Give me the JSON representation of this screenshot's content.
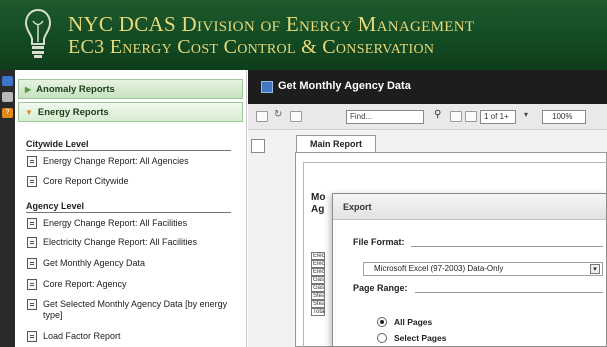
{
  "header": {
    "line1": "NYC DCAS Division of Energy Management",
    "line2": "EC3 Energy Cost Control & Conservation"
  },
  "sidebar": {
    "accordion": [
      {
        "label": "Anomaly Reports",
        "state": "collapsed"
      },
      {
        "label": "Energy Reports",
        "state": "expanded"
      }
    ],
    "sections": [
      {
        "heading": "Citywide Level",
        "items": [
          "Energy Change Report: All Agencies",
          "Core Report Citywide"
        ]
      },
      {
        "heading": "Agency Level",
        "items": [
          "Energy Change Report: All Facilities",
          "Electricity Change Report: All Facilities",
          "Get Monthly Agency Data",
          "Core Report: Agency",
          "Get Selected Monthly Agency Data [by energy type]",
          "Load Factor Report"
        ]
      }
    ]
  },
  "main": {
    "title": "Get Monthly Agency Data",
    "toolbar": {
      "find_placeholder": "Find...",
      "page_indicator": "1 of 1+",
      "zoom": "100%"
    },
    "tab_label": "Main Report",
    "report": {
      "title_partial": "Mo\nAg",
      "row_labels": [
        "Elec",
        "Elec",
        "Elec",
        "Gas",
        "Gas",
        "Stea",
        "Stea",
        "Tota"
      ]
    }
  },
  "export_dialog": {
    "title": "Export",
    "file_format_label": "File Format:",
    "file_format_value": "Microsoft Excel (97-2003) Data-Only",
    "page_range_label": "Page Range:",
    "options": [
      {
        "label": "All Pages",
        "selected": true
      },
      {
        "label": "Select Pages",
        "selected": false
      }
    ]
  },
  "colors": {
    "header_bg": "#164a24",
    "header_text": "#e8d97a",
    "accordion_green": "#c6e2bf",
    "title_bar": "#1d1d1d"
  }
}
